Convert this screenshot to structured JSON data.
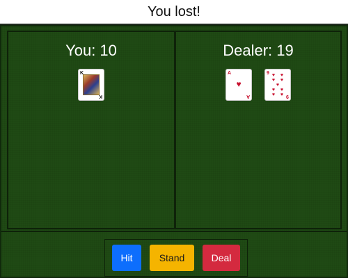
{
  "status": {
    "message": "You lost!"
  },
  "player": {
    "label": "You: 10",
    "cards": [
      {
        "rank": "K",
        "suit": "spades",
        "suit_symbol": "♠",
        "color": "black"
      }
    ]
  },
  "dealer": {
    "label": "Dealer: 19",
    "cards": [
      {
        "rank": "A",
        "suit": "hearts",
        "suit_symbol": "♥",
        "color": "red"
      },
      {
        "rank": "9",
        "suit": "hearts",
        "suit_symbol": "♥",
        "color": "red"
      }
    ]
  },
  "controls": {
    "hit_label": "Hit",
    "stand_label": "Stand",
    "deal_label": "Deal"
  },
  "colors": {
    "felt": "#1f4a14",
    "hit": "#0d6efd",
    "stand": "#f5b400",
    "deal": "#d42a3f"
  }
}
